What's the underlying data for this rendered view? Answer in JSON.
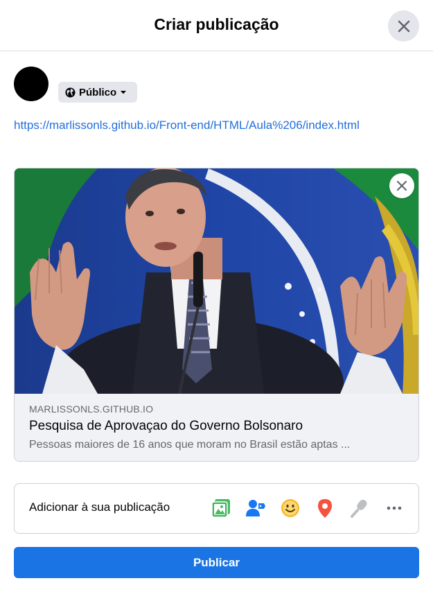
{
  "dialog": {
    "title": "Criar publicação"
  },
  "composer": {
    "privacy_label": "Público",
    "text": "https://marlissonls.github.io/Front-end/HTML/Aula%206/index.html"
  },
  "link_preview": {
    "domain": "MARLISSONLS.GITHUB.IO",
    "title": "Pesquisa de Aprovaçao do Governo Bolsonaro",
    "description": "Pessoas maiores de 16 anos que moram no Brasil estão aptas ..."
  },
  "add_to_post": {
    "label": "Adicionar à sua publicação",
    "tools": [
      "photo-video-icon",
      "tag-people-icon",
      "feeling-icon",
      "check-in-icon",
      "live-audio-icon",
      "more-icon"
    ]
  },
  "publish_button": {
    "label": "Publicar"
  },
  "colors": {
    "accent": "#1b74e4",
    "link": "#216fdb",
    "photo": "#45bd62",
    "tag": "#1877f2",
    "feeling": "#f7b928",
    "checkin": "#f5533d"
  }
}
